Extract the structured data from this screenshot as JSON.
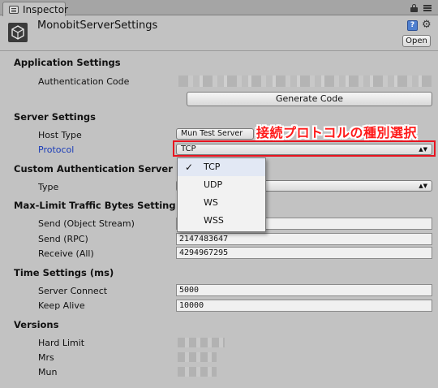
{
  "tab": {
    "label": "Inspector"
  },
  "header": {
    "title": "MonobitServerSettings",
    "open_label": "Open",
    "help_glyph": "?",
    "gear_glyph": "⚙"
  },
  "sections": {
    "application": "Application Settings",
    "server": "Server Settings",
    "custom_auth": "Custom Authentication Server",
    "max_limit": "Max-Limit Traffic Bytes Setting",
    "time": "Time Settings (ms)",
    "versions": "Versions"
  },
  "application": {
    "auth_code_label": "Authentication Code",
    "generate_label": "Generate Code"
  },
  "server": {
    "host_type_label": "Host Type",
    "host_type_value": "Mun Test Server",
    "protocol_label": "Protocol",
    "protocol_value": "TCP"
  },
  "custom_auth": {
    "type_label": "Type"
  },
  "max_limit": {
    "send_object_label": "Send (Object Stream)",
    "send_rpc_label": "Send (RPC)",
    "send_rpc_value": "2147483647",
    "receive_label": "Receive (All)",
    "receive_value": "4294967295"
  },
  "time": {
    "server_connect_label": "Server Connect",
    "server_connect_value": "5000",
    "keep_alive_label": "Keep Alive",
    "keep_alive_value": "10000"
  },
  "versions": {
    "hard_limit_label": "Hard Limit",
    "mrs_label": "Mrs",
    "mun_label": "Mun"
  },
  "protocol_dropdown": {
    "items": [
      {
        "label": "TCP",
        "checked": true
      },
      {
        "label": "UDP",
        "checked": false
      },
      {
        "label": "WS",
        "checked": false
      },
      {
        "label": "WSS",
        "checked": false
      }
    ],
    "check_glyph": "✓"
  },
  "annotation": {
    "text": "接続プロトコルの種別選択",
    "color": "#e8131f"
  },
  "icons": {
    "tab": "inspector-icon",
    "lock": "lock-icon",
    "menu": "menu-icon",
    "asset": "unity-asset-icon",
    "help": "help-icon",
    "gear": "gear-icon",
    "check": "check-icon",
    "popup_arrow": "popup-arrow-icon"
  }
}
